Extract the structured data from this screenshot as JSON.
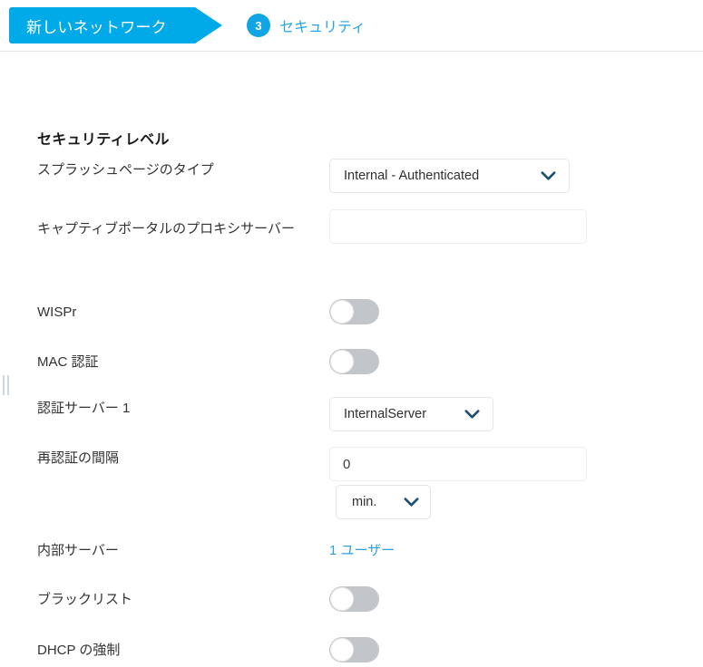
{
  "header": {
    "active_tab_label": "新しいネットワーク",
    "next_step_number": "3",
    "next_step_label": "セキュリティ",
    "accent_color": "#00a9e8",
    "badge_color": "#12a5e5",
    "link_color": "#25a6e4"
  },
  "form": {
    "section_title": "セキュリティレベル",
    "rows": {
      "splash_page_type": {
        "label": "スプラッシュページのタイプ",
        "value": "Internal - Authenticated"
      },
      "captive_portal_proxy": {
        "label": "キャプティブポータルのプロキシサーバー",
        "value": "",
        "placeholder": ""
      },
      "wispr": {
        "label": "WISPr",
        "state": "off"
      },
      "mac_auth": {
        "label": "MAC 認証",
        "state": "off"
      },
      "auth_server_1": {
        "label": "認証サーバー 1",
        "value": "InternalServer",
        "add_icon": "plus-icon",
        "add_icon_color": "#00a8ee"
      },
      "reauth_interval": {
        "label": "再認証の間隔",
        "value": "0",
        "unit": "min."
      },
      "internal_server": {
        "label": "内部サーバー",
        "link_text": "1 ユーザー"
      },
      "blacklisting": {
        "label": "ブラックリスト",
        "state": "off"
      },
      "dhcp_enforcement": {
        "label": "DHCP の強制",
        "state": "off"
      }
    }
  }
}
